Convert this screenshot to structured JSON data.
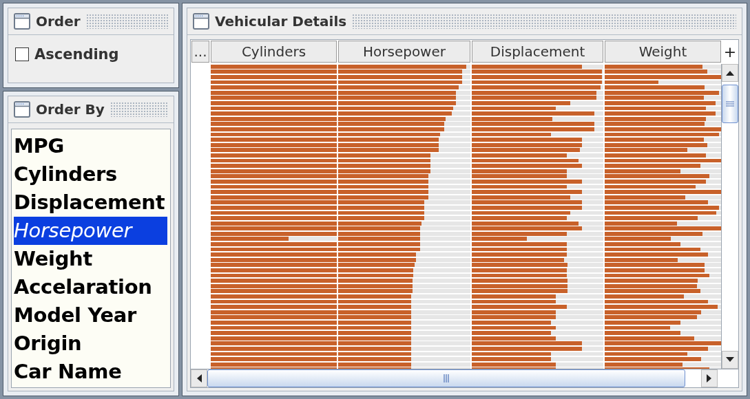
{
  "order_panel": {
    "title": "Order",
    "ascending": {
      "label": "Ascending",
      "checked": false
    }
  },
  "order_by_panel": {
    "title": "Order By",
    "items": [
      {
        "label": "MPG",
        "selected": false
      },
      {
        "label": "Cylinders",
        "selected": false
      },
      {
        "label": "Displacement",
        "selected": false
      },
      {
        "label": "Horsepower",
        "selected": true
      },
      {
        "label": "Weight",
        "selected": false
      },
      {
        "label": "Accelaration",
        "selected": false
      },
      {
        "label": "Model Year",
        "selected": false
      },
      {
        "label": "Origin",
        "selected": false
      },
      {
        "label": "Car Name",
        "selected": false
      }
    ]
  },
  "details_panel": {
    "title": "Vehicular Details",
    "corner": "...",
    "add": "+",
    "columns": [
      "Cylinders",
      "Horsepower",
      "Displacement",
      "Weight"
    ],
    "rows": [
      {
        "cells": [
          {
            "level": 1
          },
          {
            "level": 0.97
          },
          {
            "level": 0.84
          },
          {
            "level": 0.84
          }
        ]
      },
      {
        "cells": [
          {
            "level": 1
          },
          {
            "level": 0.94
          },
          {
            "level": 0.99
          },
          {
            "level": 0.88
          }
        ]
      },
      {
        "cells": [
          {
            "level": 1
          },
          {
            "level": 0.94
          },
          {
            "level": 0.99
          },
          {
            "level": 1
          }
        ]
      },
      {
        "cells": [
          {
            "level": 1
          },
          {
            "level": 0.94
          },
          {
            "level": 0.99
          },
          {
            "level": 0.46
          }
        ]
      },
      {
        "cells": [
          {
            "level": 1
          },
          {
            "level": 0.91
          },
          {
            "level": 0.98
          },
          {
            "level": 0.86
          }
        ]
      },
      {
        "cells": [
          {
            "level": 1
          },
          {
            "level": 0.89
          },
          {
            "level": 0.95
          },
          {
            "level": 0.98
          }
        ]
      },
      {
        "cells": [
          {
            "level": 1
          },
          {
            "level": 0.89
          },
          {
            "level": 0.95
          },
          {
            "level": 0.85
          }
        ]
      },
      {
        "cells": [
          {
            "level": 1
          },
          {
            "level": 0.89
          },
          {
            "level": 0.75
          },
          {
            "level": 0.95
          }
        ]
      },
      {
        "cells": [
          {
            "level": 1
          },
          {
            "level": 0.87
          },
          {
            "level": 0.64
          },
          {
            "level": 0.87
          }
        ]
      },
      {
        "cells": [
          {
            "level": 1
          },
          {
            "level": 0.86
          },
          {
            "level": 0.93
          },
          {
            "level": 0.95
          }
        ]
      },
      {
        "cells": [
          {
            "level": 1
          },
          {
            "level": 0.81
          },
          {
            "level": 0.61
          },
          {
            "level": 0.87
          }
        ]
      },
      {
        "cells": [
          {
            "level": 1
          },
          {
            "level": 0.8
          },
          {
            "level": 0.93
          },
          {
            "level": 0.86
          }
        ]
      },
      {
        "cells": [
          {
            "level": 1
          },
          {
            "level": 0.8
          },
          {
            "level": 0.93
          },
          {
            "level": 1
          }
        ]
      },
      {
        "cells": [
          {
            "level": 1
          },
          {
            "level": 0.77
          },
          {
            "level": 0.6
          },
          {
            "level": 0.98
          }
        ]
      },
      {
        "cells": [
          {
            "level": 1
          },
          {
            "level": 0.76
          },
          {
            "level": 0.84
          },
          {
            "level": 0.85
          }
        ]
      },
      {
        "cells": [
          {
            "level": 1
          },
          {
            "level": 0.76
          },
          {
            "level": 0.84
          },
          {
            "level": 0.88
          }
        ]
      },
      {
        "cells": [
          {
            "level": 1
          },
          {
            "level": 0.76
          },
          {
            "level": 0.82
          },
          {
            "level": 0.71
          }
        ]
      },
      {
        "cells": [
          {
            "level": 1
          },
          {
            "level": 0.7
          },
          {
            "level": 0.72
          },
          {
            "level": 0.87
          }
        ]
      },
      {
        "cells": [
          {
            "level": 1
          },
          {
            "level": 0.7
          },
          {
            "level": 0.81
          },
          {
            "level": 1
          }
        ]
      },
      {
        "cells": [
          {
            "level": 1
          },
          {
            "level": 0.7
          },
          {
            "level": 0.84
          },
          {
            "level": 0.82
          }
        ]
      },
      {
        "cells": [
          {
            "level": 1
          },
          {
            "level": 0.7
          },
          {
            "level": 0.72
          },
          {
            "level": 0.65
          }
        ]
      },
      {
        "cells": [
          {
            "level": 1
          },
          {
            "level": 0.68
          },
          {
            "level": 0.72
          },
          {
            "level": 0.9
          }
        ]
      },
      {
        "cells": [
          {
            "level": 1
          },
          {
            "level": 0.68
          },
          {
            "level": 0.84
          },
          {
            "level": 0.87
          }
        ]
      },
      {
        "cells": [
          {
            "level": 1
          },
          {
            "level": 0.68
          },
          {
            "level": 0.72
          },
          {
            "level": 0.78
          }
        ]
      },
      {
        "cells": [
          {
            "level": 1
          },
          {
            "level": 0.68
          },
          {
            "level": 0.84
          },
          {
            "level": 1
          }
        ]
      },
      {
        "cells": [
          {
            "level": 1
          },
          {
            "level": 0.68
          },
          {
            "level": 0.75
          },
          {
            "level": 0.69
          }
        ]
      },
      {
        "cells": [
          {
            "level": 1
          },
          {
            "level": 0.65
          },
          {
            "level": 0.84
          },
          {
            "level": 0.89
          }
        ]
      },
      {
        "cells": [
          {
            "level": 1
          },
          {
            "level": 0.65
          },
          {
            "level": 0.84
          },
          {
            "level": 0.98
          }
        ]
      },
      {
        "cells": [
          {
            "level": 1
          },
          {
            "level": 0.65
          },
          {
            "level": 0.75
          },
          {
            "level": 0.96
          }
        ]
      },
      {
        "cells": [
          {
            "level": 1
          },
          {
            "level": 0.65
          },
          {
            "level": 0.72
          },
          {
            "level": 0.8
          }
        ]
      },
      {
        "cells": [
          {
            "level": 1
          },
          {
            "level": 0.63
          },
          {
            "level": 0.81
          },
          {
            "level": 0.62
          }
        ]
      },
      {
        "cells": [
          {
            "level": 1
          },
          {
            "level": 0.62
          },
          {
            "level": 0.84
          },
          {
            "level": 1
          }
        ]
      },
      {
        "cells": [
          {
            "level": 1
          },
          {
            "level": 0.62
          },
          {
            "level": 0.72
          },
          {
            "level": 0.84
          }
        ]
      },
      {
        "cells": [
          {
            "level": 0.62
          },
          {
            "level": 0.62
          },
          {
            "level": 0.42
          },
          {
            "level": 0.57
          }
        ]
      },
      {
        "cells": [
          {
            "level": 1
          },
          {
            "level": 0.62
          },
          {
            "level": 0.72
          },
          {
            "level": 0.65
          }
        ]
      },
      {
        "cells": [
          {
            "level": 1
          },
          {
            "level": 0.62
          },
          {
            "level": 0.72
          },
          {
            "level": 0.82
          }
        ]
      },
      {
        "cells": [
          {
            "level": 1
          },
          {
            "level": 0.59
          },
          {
            "level": 0.72
          },
          {
            "level": 0.89
          }
        ]
      },
      {
        "cells": [
          {
            "level": 1
          },
          {
            "level": 0.59
          },
          {
            "level": 0.7
          },
          {
            "level": 0.63
          }
        ]
      },
      {
        "cells": [
          {
            "level": 1
          },
          {
            "level": 0.58
          },
          {
            "level": 0.73
          },
          {
            "level": 0.86
          }
        ]
      },
      {
        "cells": [
          {
            "level": 1
          },
          {
            "level": 0.57
          },
          {
            "level": 0.72
          },
          {
            "level": 0.86
          }
        ]
      },
      {
        "cells": [
          {
            "level": 1
          },
          {
            "level": 0.57
          },
          {
            "level": 0.72
          },
          {
            "level": 0.9
          }
        ]
      },
      {
        "cells": [
          {
            "level": 1
          },
          {
            "level": 0.56
          },
          {
            "level": 0.73
          },
          {
            "level": 0.8
          }
        ]
      },
      {
        "cells": [
          {
            "level": 1
          },
          {
            "level": 0.56
          },
          {
            "level": 0.73
          },
          {
            "level": 0.79
          }
        ]
      },
      {
        "cells": [
          {
            "level": 1
          },
          {
            "level": 0.56
          },
          {
            "level": 0.73
          },
          {
            "level": 0.82
          }
        ]
      },
      {
        "cells": [
          {
            "level": 1
          },
          {
            "level": 0.55
          },
          {
            "level": 0.64
          },
          {
            "level": 0.68
          }
        ]
      },
      {
        "cells": [
          {
            "level": 1
          },
          {
            "level": 0.55
          },
          {
            "level": 0.64
          },
          {
            "level": 0.89
          }
        ]
      },
      {
        "cells": [
          {
            "level": 1
          },
          {
            "level": 0.55
          },
          {
            "level": 0.72
          },
          {
            "level": 0.97
          }
        ]
      },
      {
        "cells": [
          {
            "level": 1
          },
          {
            "level": 0.55
          },
          {
            "level": 0.64
          },
          {
            "level": 0.83
          }
        ]
      },
      {
        "cells": [
          {
            "level": 1
          },
          {
            "level": 0.55
          },
          {
            "level": 0.64
          },
          {
            "level": 0.79
          }
        ]
      },
      {
        "cells": [
          {
            "level": 1
          },
          {
            "level": 0.55
          },
          {
            "level": 0.6
          },
          {
            "level": 0.65
          }
        ]
      },
      {
        "cells": [
          {
            "level": 1
          },
          {
            "level": 0.55
          },
          {
            "level": 0.64
          },
          {
            "level": 0.56
          }
        ]
      },
      {
        "cells": [
          {
            "level": 1
          },
          {
            "level": 0.55
          },
          {
            "level": 0.6
          },
          {
            "level": 0.65
          }
        ]
      },
      {
        "cells": [
          {
            "level": 1
          },
          {
            "level": 0.55
          },
          {
            "level": 0.64
          },
          {
            "level": 0.77
          }
        ]
      },
      {
        "cells": [
          {
            "level": 1
          },
          {
            "level": 0.55
          },
          {
            "level": 0.84
          },
          {
            "level": 1
          }
        ]
      },
      {
        "cells": [
          {
            "level": 1
          },
          {
            "level": 0.55
          },
          {
            "level": 0.84
          },
          {
            "level": 0.89
          }
        ]
      },
      {
        "cells": [
          {
            "level": 1
          },
          {
            "level": 0.55
          },
          {
            "level": 0.6
          },
          {
            "level": 0.71
          }
        ]
      },
      {
        "cells": [
          {
            "level": 1
          },
          {
            "level": 0.55
          },
          {
            "level": 0.6
          },
          {
            "level": 0.83
          }
        ]
      },
      {
        "cells": [
          {
            "level": 1
          },
          {
            "level": 0.55
          },
          {
            "level": 0.64
          },
          {
            "level": 0.67
          }
        ]
      },
      {
        "cells": [
          {
            "level": 1
          },
          {
            "level": 0.55
          },
          {
            "level": 0.64
          },
          {
            "level": 0.9
          }
        ]
      }
    ]
  }
}
